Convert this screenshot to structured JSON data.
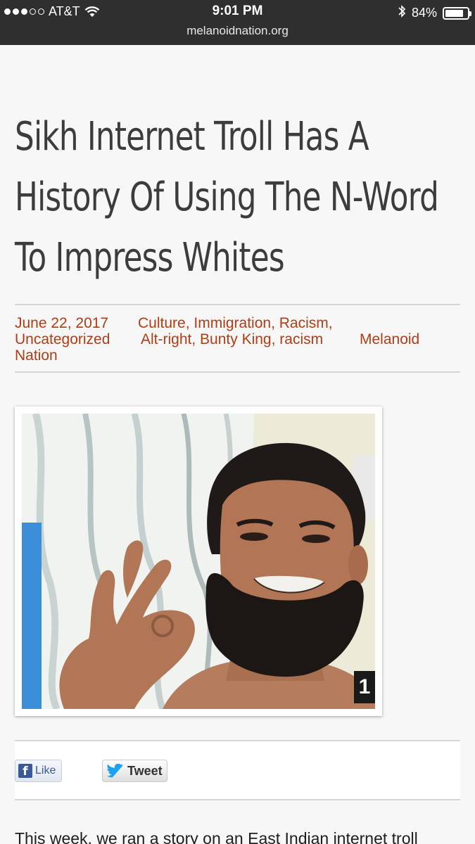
{
  "status_bar": {
    "carrier": "AT&T",
    "time": "9:01 PM",
    "battery": "84%",
    "battery_level": 0.84
  },
  "browser": {
    "url": "melanoidnation.org"
  },
  "article": {
    "title": "Sikh Internet Troll Has A History Of Using The N-Word To Impress Whites",
    "date": "June 22, 2017",
    "categories": [
      "Culture",
      "Immigration",
      "Racism",
      "Uncategorized"
    ],
    "tags": [
      "Alt-right",
      "Bunty King",
      "racism"
    ],
    "author_line1": "Melanoid",
    "author_line2": "Nation",
    "photo_badge": "1",
    "body_start": "This week, we ran a story on an East Indian internet troll who's twitter page was deleted because of his"
  },
  "share": {
    "like_label": "Like",
    "tweet_label": "Tweet"
  },
  "colors": {
    "link": "#b23d14",
    "topbar": "#2f2f2f",
    "facebook": "#3b5998",
    "twitter": "#1da1f2"
  }
}
